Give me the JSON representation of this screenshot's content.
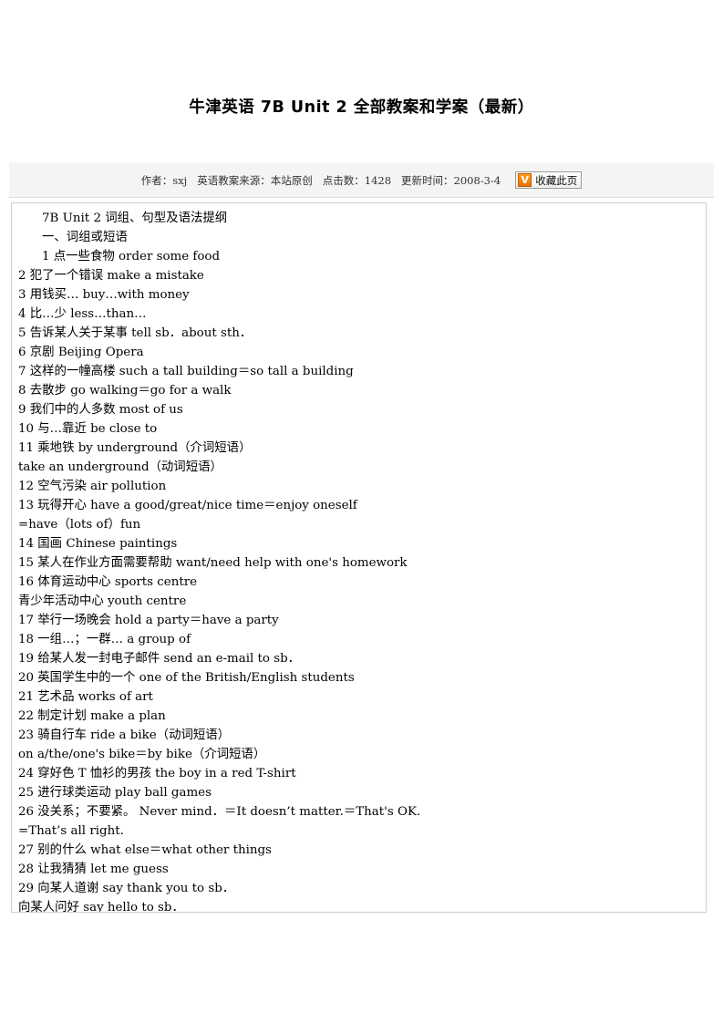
{
  "page": {
    "title": "牛津英语 7B  Unit  2  全部教案和学案（最新）"
  },
  "meta": {
    "author": "作者：sxj",
    "source": "英语教案来源：本站原创",
    "hits": "点击数：1428",
    "updated": "更新时间：2008-3-4",
    "favourite_button": {
      "icon_glyph": "V",
      "icon_color": "#ef7d00",
      "label": "收藏此页"
    }
  },
  "content": {
    "lines": [
      {
        "text": "7B  Unit  2 词组、句型及语法提纲",
        "indent": true
      },
      {
        "text": "一、词组或短语",
        "indent": true
      },
      {
        "text": "1  点一些食物  order  some  food",
        "indent": true
      },
      {
        "text": "2  犯了一个错误  make  a  mistake",
        "indent": false
      },
      {
        "text": "3  用钱买…  buy…with  money",
        "indent": false
      },
      {
        "text": "4  比…少  less…than…",
        "indent": false
      },
      {
        "text": "5  告诉某人关于某事  tell  sb．about  sth．",
        "indent": false
      },
      {
        "text": "6  京剧  Beijing  Opera",
        "indent": false
      },
      {
        "text": "7  这样的一幢高楼  such  a  tall  building＝so  tall  a  building",
        "indent": false
      },
      {
        "text": "8  去散步  go  walking＝go  for  a  walk",
        "indent": false
      },
      {
        "text": "9  我们中的人多数  most  of  us",
        "indent": false
      },
      {
        "text": "10  与…靠近  be  close  to",
        "indent": false
      },
      {
        "text": "11  乘地铁  by  underground（介词短语）",
        "indent": false
      },
      {
        "text": "take  an  underground（动词短语）",
        "indent": false
      },
      {
        "text": "12  空气污染  air  pollution",
        "indent": false
      },
      {
        "text": "13  玩得开心  have  a  good/great/nice  time＝enjoy  oneself",
        "indent": false
      },
      {
        "text": "=have（lots  of）fun",
        "indent": false
      },
      {
        "text": "14  国画  Chinese  paintings",
        "indent": false
      },
      {
        "text": "15  某人在作业方面需要帮助 want/need  help  with  one's  homework",
        "indent": false
      },
      {
        "text": "16  体育运动中心  sports  centre",
        "indent": false
      },
      {
        "text": "青少年活动中心  youth  centre",
        "indent": false
      },
      {
        "text": "17  举行一场晚会  hold  a  party＝have a  party",
        "indent": false
      },
      {
        "text": "18  一组…；一群…  a  group  of",
        "indent": false
      },
      {
        "text": "19  给某人发一封电子邮件  send  an  e-mail  to  sb．",
        "indent": false
      },
      {
        "text": "20  英国学生中的一个  one  of  the  British/English  students",
        "indent": false
      },
      {
        "text": "21  艺术品  works  of  art",
        "indent": false
      },
      {
        "text": "22  制定计划  make  a  plan",
        "indent": false
      },
      {
        "text": "23  骑自行车  ride  a  bike（动词短语）",
        "indent": false
      },
      {
        "text": "on  a/the/one's  bike＝by  bike（介词短语）",
        "indent": false
      },
      {
        "text": "24  穿好色 T 恤衫的男孩  the  boy  in  a  red  T-shirt",
        "indent": false
      },
      {
        "text": "25  进行球类运动  play  ball  games",
        "indent": false
      },
      {
        "text": "26  没关系；不要紧。  Never  mind．＝It  doesn’t  matter.＝That's  OK.",
        "indent": false
      },
      {
        "text": "=That’s  all  right.",
        "indent": false
      },
      {
        "text": "27  别的什么  what  else＝what  other  things",
        "indent": false
      },
      {
        "text": "28  让我猜猜  let  me  guess",
        "indent": false
      },
      {
        "text": "29  向某人道谢  say  thank  you  to  sb．",
        "indent": false
      },
      {
        "text": "向某人问好  say  hello  to  sb．",
        "indent": false
      }
    ]
  }
}
